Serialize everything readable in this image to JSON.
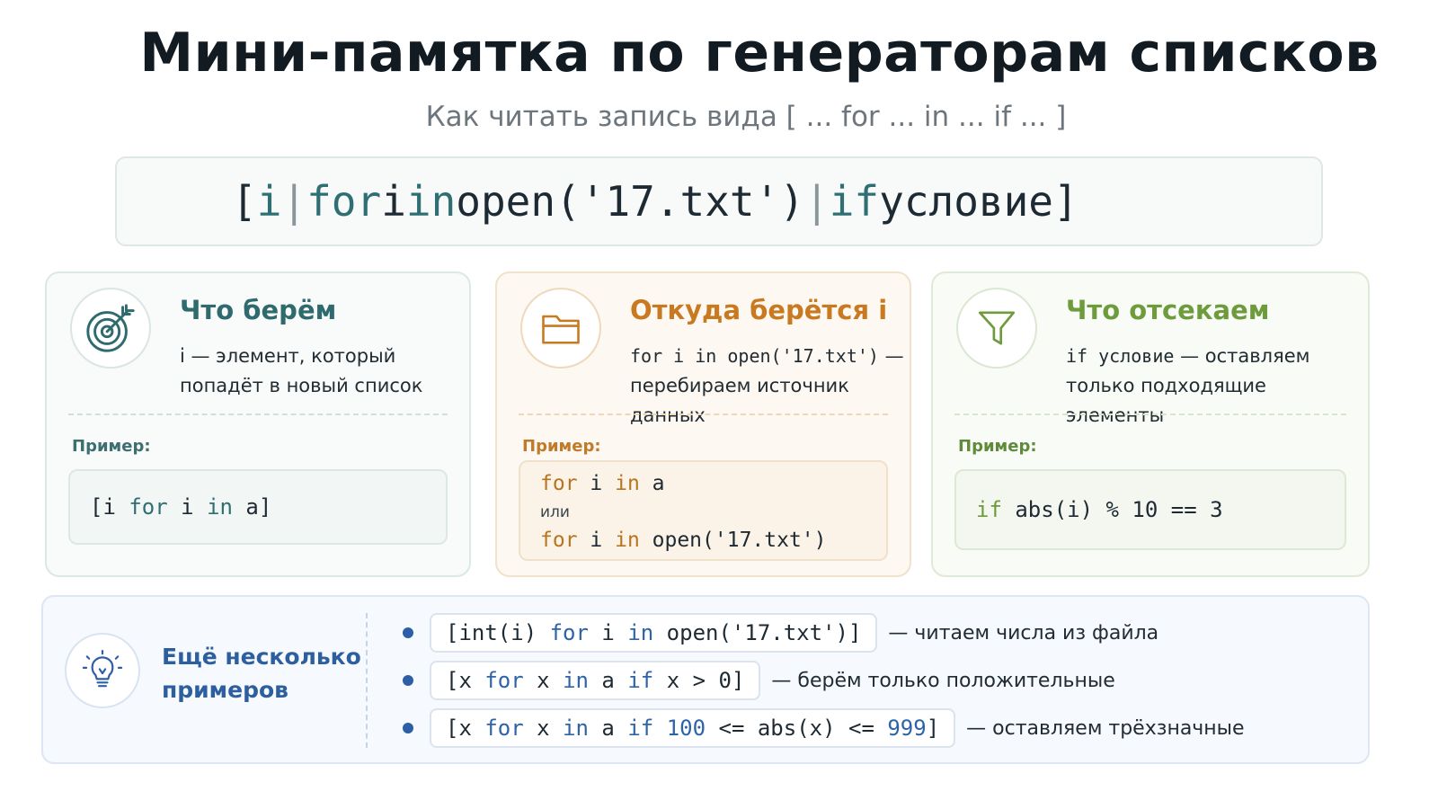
{
  "header": {
    "title": "Мини-памятка по генераторам списков",
    "subtitle": "Как читать запись вида [ ... for ... in ... if ... ]"
  },
  "formula": {
    "open_bracket": "[",
    "item": "i",
    "sep1": "|",
    "for_kw": "for",
    "var": "i",
    "in_kw": "in",
    "source": "open('17.txt')",
    "sep2": "|",
    "if_kw": "if",
    "condition": "условие",
    "close_bracket": "]"
  },
  "cards": {
    "take": {
      "icon": "target-icon",
      "title": "Что берём",
      "desc_line1": "i — элемент, который",
      "desc_line2": "попадёт в новый список",
      "example_label": "Пример:",
      "code": {
        "open": "[i ",
        "for_kw": "for",
        "mid": " i ",
        "in_kw": "in",
        "tail": " a]"
      }
    },
    "source": {
      "icon": "folder-icon",
      "title": "Откуда берётся i",
      "desc_code": "for i in open('17.txt')",
      "desc_dash": " —",
      "desc_line2": "перебираем источник данных",
      "example_label": "Пример:",
      "line1": {
        "for_kw": "for",
        "mid": " i ",
        "in_kw": "in",
        "tail": " a"
      },
      "or_text": "или",
      "line2": {
        "for_kw": "for",
        "mid": " i ",
        "in_kw": "in",
        "tail": " open('17.txt')"
      }
    },
    "filter": {
      "icon": "filter-icon",
      "title": "Что отсекаем",
      "desc_code": "if условие",
      "desc_rest": " — оставляем",
      "desc_line2": "только подходящие элементы",
      "example_label": "Пример:",
      "code": {
        "if_kw": "if",
        "tail": " abs(i) % 10 == 3"
      }
    }
  },
  "more": {
    "icon": "lightbulb-icon",
    "title_line1": "Ещё несколько",
    "title_line2": "примеров",
    "examples": [
      {
        "p1": "[int(i) ",
        "for_kw": "for",
        "p2": " i ",
        "in_kw": "in",
        "p3": " open('17.txt')]",
        "note": "— читаем числа из файла"
      },
      {
        "p1": "[x ",
        "for_kw": "for",
        "p2": " x ",
        "in_kw": "in",
        "p3": " a ",
        "if_kw": "if",
        "p4": " x > 0]",
        "note": "— берём только положительные"
      },
      {
        "p1": "[x ",
        "for_kw": "for",
        "p2": " x ",
        "in_kw": "in",
        "p3": " a ",
        "if_kw": "if",
        "p4": " ",
        "n1": "100",
        "p5": " <= abs(x) <= ",
        "n2": "999",
        "p6": "]",
        "note": "— оставляем трёхзначные"
      }
    ]
  }
}
